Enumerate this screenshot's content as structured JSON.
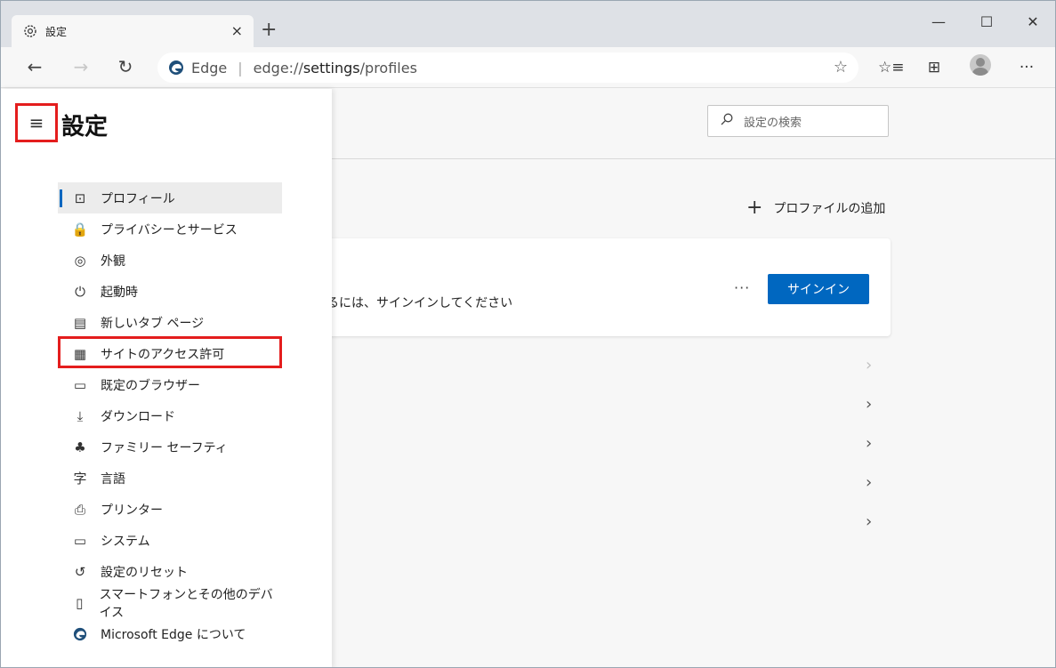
{
  "tab": {
    "title": "設定",
    "close": "×",
    "new_tab": "+"
  },
  "window_controls": {
    "minimize": "—",
    "maximize": "☐",
    "close": "✕"
  },
  "toolbar": {
    "back": "←",
    "forward": "→",
    "refresh": "↻",
    "site_label": "Edge",
    "separator": "|",
    "url_prefix": "edge://",
    "url_bold": "settings",
    "url_suffix": "/profiles",
    "favorite": "☆",
    "favorites_list": "☆≡",
    "collections": "⊞",
    "more": "···"
  },
  "sidebar": {
    "menu_icon": "≡",
    "title": "設定",
    "items": [
      {
        "label": "プロフィール",
        "icon": "profile-icon",
        "glyph": "⊡"
      },
      {
        "label": "プライバシーとサービス",
        "icon": "lock-icon",
        "glyph": "🔒"
      },
      {
        "label": "外観",
        "icon": "palette-icon",
        "glyph": "◎"
      },
      {
        "label": "起動時",
        "icon": "power-icon",
        "glyph": "⏻"
      },
      {
        "label": "新しいタブ ページ",
        "icon": "new-tab-page-icon",
        "glyph": "▤"
      },
      {
        "label": "サイトのアクセス許可",
        "icon": "site-permissions-icon",
        "glyph": "▦"
      },
      {
        "label": "既定のブラウザー",
        "icon": "default-browser-icon",
        "glyph": "▭"
      },
      {
        "label": "ダウンロード",
        "icon": "download-icon",
        "glyph": "⤓"
      },
      {
        "label": "ファミリー セーフティ",
        "icon": "family-icon",
        "glyph": "♣"
      },
      {
        "label": "言語",
        "icon": "language-icon",
        "glyph": "字"
      },
      {
        "label": "プリンター",
        "icon": "printer-icon",
        "glyph": "⎙"
      },
      {
        "label": "システム",
        "icon": "system-icon",
        "glyph": "▭"
      },
      {
        "label": "設定のリセット",
        "icon": "reset-icon",
        "glyph": "↺"
      },
      {
        "label": "スマートフォンとその他のデバイス",
        "icon": "phone-icon",
        "glyph": "▯"
      },
      {
        "label": "Microsoft Edge について",
        "icon": "edge-icon",
        "glyph": ""
      }
    ]
  },
  "main": {
    "search_placeholder": "設定の検索",
    "add_profile": "プロファイルの追加",
    "add_profile_plus": "+",
    "card_text": "るには、サインインしてください",
    "card_more": "···",
    "signin": "サインイン",
    "chevron": "›"
  },
  "colors": {
    "accent": "#0067c0",
    "highlight": "#e41d1d"
  }
}
